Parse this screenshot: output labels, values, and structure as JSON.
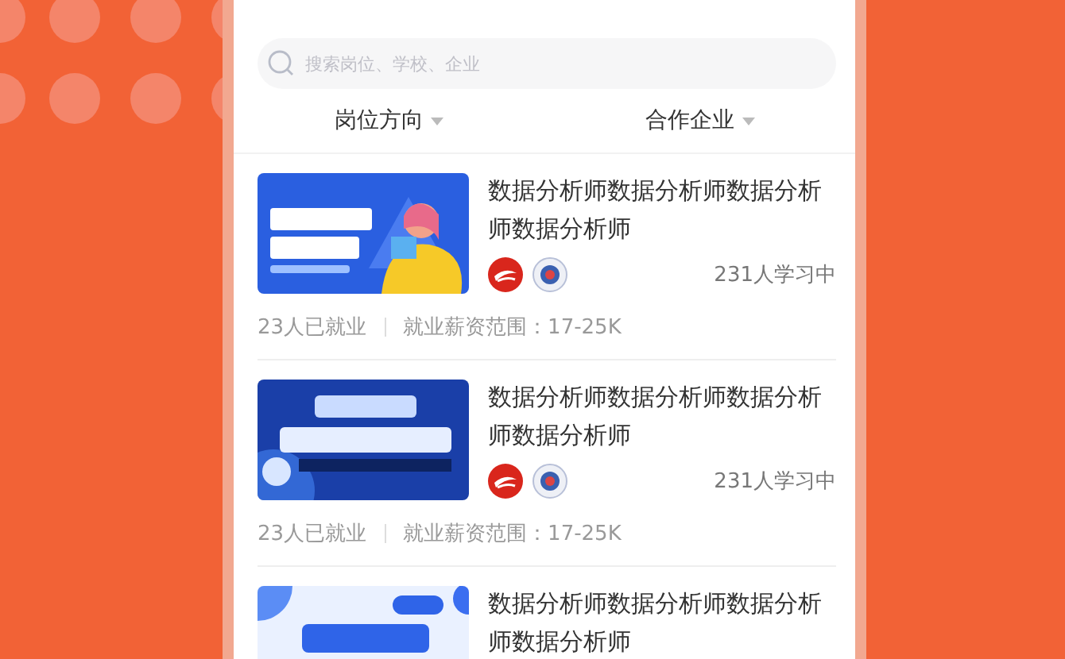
{
  "search": {
    "placeholder": "搜索岗位、学校、企业"
  },
  "filters": [
    {
      "label": "岗位方向"
    },
    {
      "label": "合作企业"
    }
  ],
  "courses": [
    {
      "kind": "full",
      "title": "数据分析师数据分析师数据分析师数据分析师",
      "learners": "231人学习中",
      "employed": "23人已就业",
      "salary": "就业薪资范围：17-25K"
    },
    {
      "kind": "full",
      "title": "数据分析师数据分析师数据分析师数据分析师",
      "learners": "231人学习中",
      "employed": "23人已就业",
      "salary": "就业薪资范围：17-25K"
    },
    {
      "kind": "partial",
      "title": "数据分析师数据分析师数据分析师数据分析师"
    }
  ]
}
